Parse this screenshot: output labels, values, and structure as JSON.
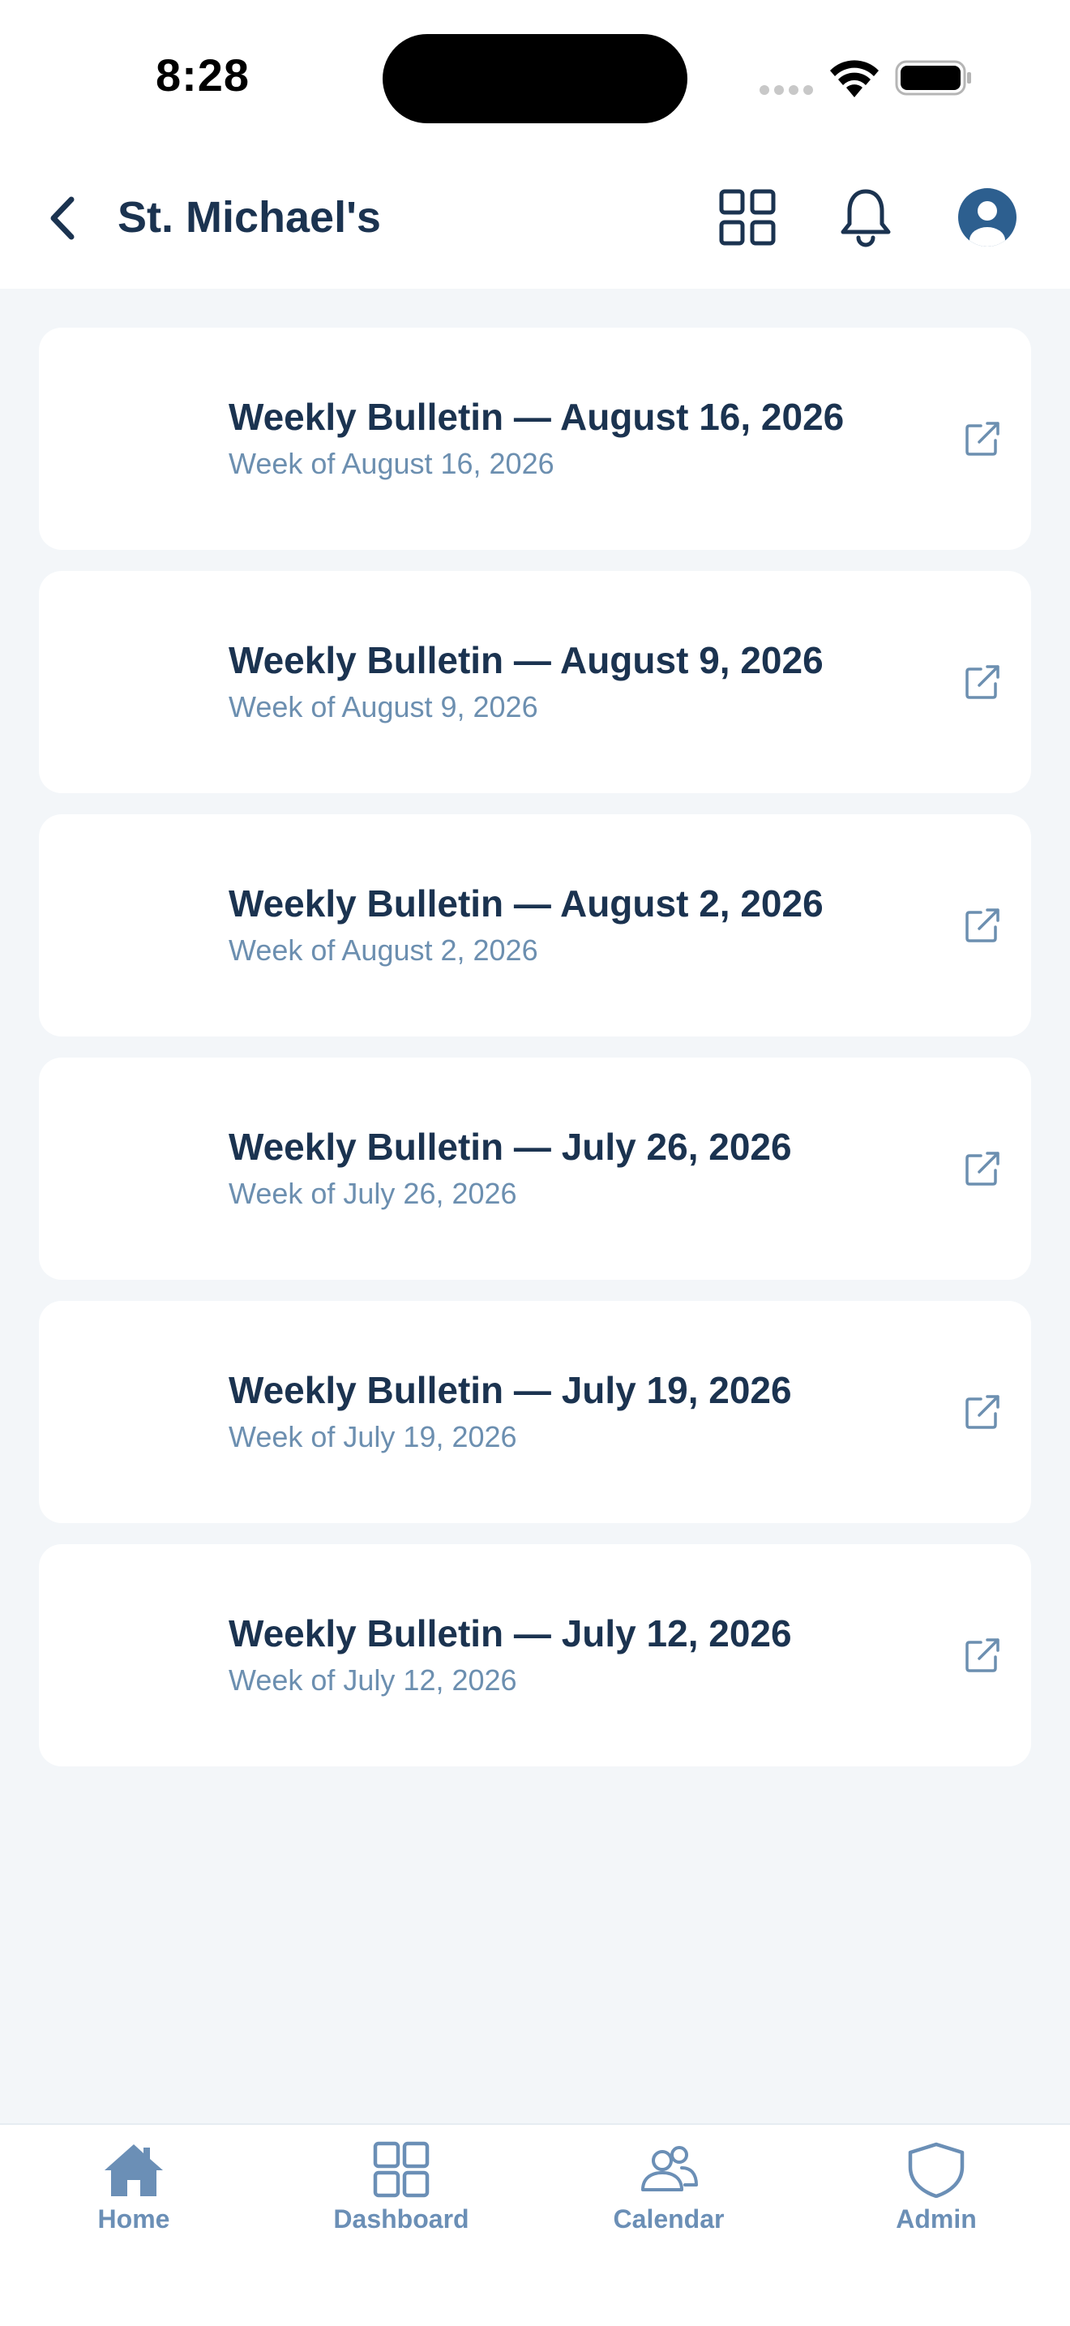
{
  "status_bar": {
    "time": "8:28"
  },
  "header": {
    "title": "St. Michael's"
  },
  "bulletins": [
    {
      "title": "Weekly Bulletin — August 16, 2026",
      "subtitle": "Week of August 16, 2026"
    },
    {
      "title": "Weekly Bulletin — August 9, 2026",
      "subtitle": "Week of August 9, 2026"
    },
    {
      "title": "Weekly Bulletin — August 2, 2026",
      "subtitle": "Week of August 2, 2026"
    },
    {
      "title": "Weekly Bulletin — July 26, 2026",
      "subtitle": "Week of July 26, 2026"
    },
    {
      "title": "Weekly Bulletin — July 19, 2026",
      "subtitle": "Week of July 19, 2026"
    },
    {
      "title": "Weekly Bulletin — July 12, 2026",
      "subtitle": "Week of July 12, 2026"
    }
  ],
  "tabs": [
    {
      "label": "Home",
      "icon": "home-icon"
    },
    {
      "label": "Dashboard",
      "icon": "dashboard-icon"
    },
    {
      "label": "Calendar",
      "icon": "people-icon"
    },
    {
      "label": "Admin",
      "icon": "shield-icon"
    }
  ],
  "colors": {
    "primary_text": "#1b3350",
    "secondary_text": "#6c8fb0",
    "tab_active": "#6b8fb6",
    "background": "#f3f6f9",
    "accent": "#2d5f8f"
  }
}
